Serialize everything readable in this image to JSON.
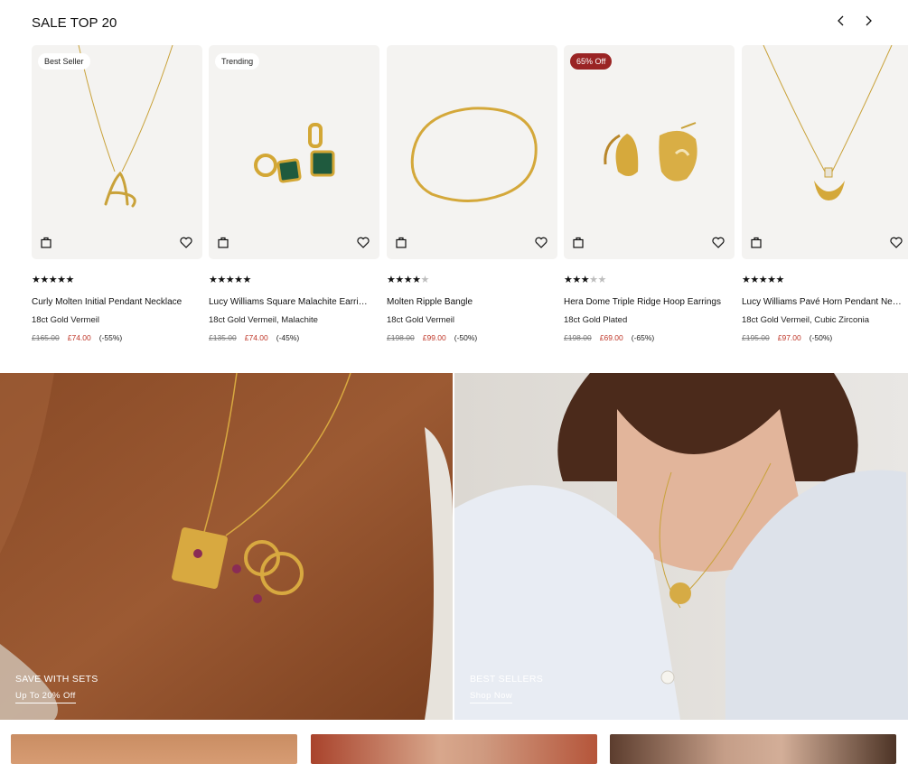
{
  "section": {
    "title": "SALE TOP 20"
  },
  "icons": {
    "prev": "chevron-left-icon",
    "next": "chevron-right-icon",
    "bag": "shopping-bag-icon",
    "wishlist": "heart-icon"
  },
  "colors": {
    "sale_price": "#c0392b",
    "sale_badge": "#9a2424",
    "card_bg": "#f4f3f1"
  },
  "products": [
    {
      "badge": "Best Seller",
      "rating": 5,
      "name": "Curly Molten Initial Pendant Necklace",
      "material": "18ct Gold Vermeil",
      "old_price": "£165.00",
      "price": "£74.00",
      "discount": "(-55%)"
    },
    {
      "badge": "Trending",
      "rating": 5,
      "name": "Lucy Williams Square Malachite Earrings",
      "material": "18ct Gold Vermeil, Malachite",
      "old_price": "£135.00",
      "price": "£74.00",
      "discount": "(-45%)"
    },
    {
      "badge": "",
      "rating": 4.5,
      "name": "Molten Ripple Bangle",
      "material": "18ct Gold Vermeil",
      "old_price": "£198.00",
      "price": "£99.00",
      "discount": "(-50%)"
    },
    {
      "badge": "65% Off",
      "rating": 3,
      "name": "Hera Dome Triple Ridge Hoop Earrings",
      "material": "18ct Gold Plated",
      "old_price": "£198.00",
      "price": "£69.00",
      "discount": "(-65%)"
    },
    {
      "badge": "",
      "rating": 5,
      "name": "Lucy Williams Pavé Horn Pendant Necklace",
      "material": "18ct Gold Vermeil, Cubic Zirconia",
      "old_price": "£195.00",
      "price": "£97.00",
      "discount": "(-50%)"
    }
  ],
  "banners": {
    "sets": {
      "title": "SAVE WITH SETS",
      "link": "Up To 20% Off"
    },
    "best": {
      "title": "BEST SELLERS",
      "link": "Shop Now"
    }
  }
}
